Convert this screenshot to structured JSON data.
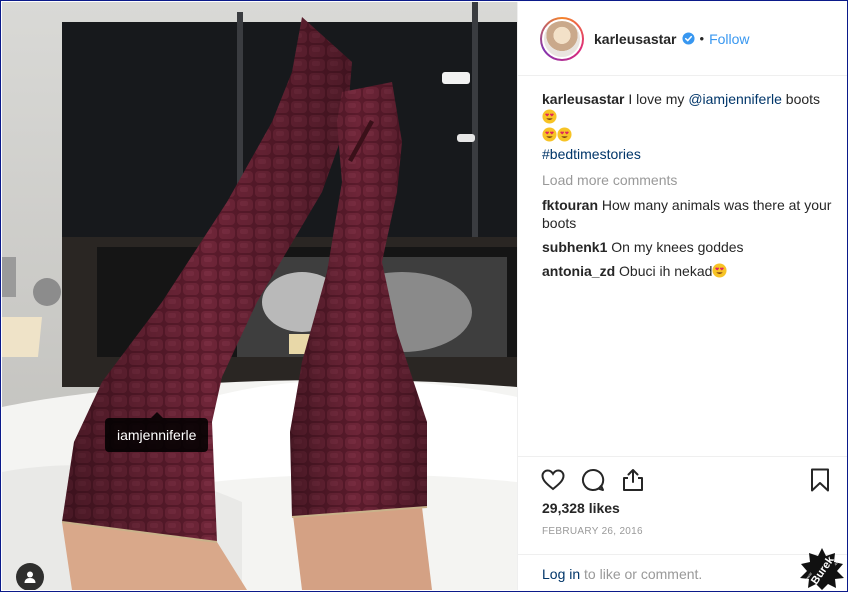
{
  "photo": {
    "tag_label": "iamjenniferle",
    "user_tags_icon": "person-tag-icon"
  },
  "post": {
    "username": "karleusastar",
    "verified_icon": "verified-badge-icon",
    "separator": "•",
    "follow_label": "Follow"
  },
  "caption": {
    "username": "karleusastar",
    "text_before": "I love my",
    "mention": "@iamjenniferle",
    "text_after": "boots",
    "hashtag": "#bedtimestories",
    "emoji_icon": "heart-eyes-emoji"
  },
  "load_more": "Load more comments",
  "comments": [
    {
      "username": "fktouran",
      "text": "How many animals was there at your boots"
    },
    {
      "username": "subhenk1",
      "text": "On my knees goddes"
    },
    {
      "username": "antonia_zd",
      "text": "Obuci ih nekad"
    }
  ],
  "actions": {
    "like_icon": "heart-icon",
    "comment_icon": "comment-icon",
    "share_icon": "share-icon",
    "save_icon": "bookmark-icon"
  },
  "likes": "29,328 likes",
  "date": "FEBRUARY 26, 2016",
  "login": {
    "link": "Log in",
    "rest": "to like or comment."
  },
  "watermark": {
    "text": "Burek",
    "small": "www",
    "suffix": ".com"
  },
  "colors": {
    "accent": "#3897f0",
    "link": "#003569",
    "muted": "#999999",
    "boot": "#5a1a2a"
  }
}
